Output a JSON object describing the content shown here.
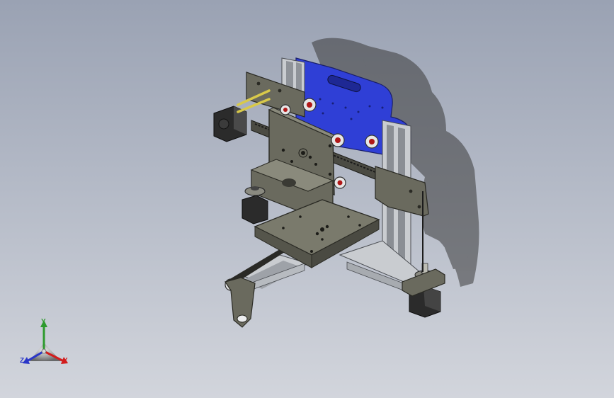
{
  "view": {
    "background_top": "#9aa2b3",
    "background_bottom": "#d2d5dc"
  },
  "model": {
    "plate_color": "#6a6a5e",
    "plate_edge": "#2a2a24",
    "carriage_color": "#2f3fd6",
    "rail_color": "#c9ccd0",
    "motor_color": "#2b2b2b",
    "shadow_color": "#3a3a3a",
    "bearing_color": "#b01818",
    "rod_color": "#d8c94a"
  },
  "triad": {
    "x_label": "X",
    "y_label": "Y",
    "z_label": "Z",
    "x_color": "#d21c1c",
    "y_color": "#2d9a2d",
    "z_color": "#2a36c8"
  }
}
